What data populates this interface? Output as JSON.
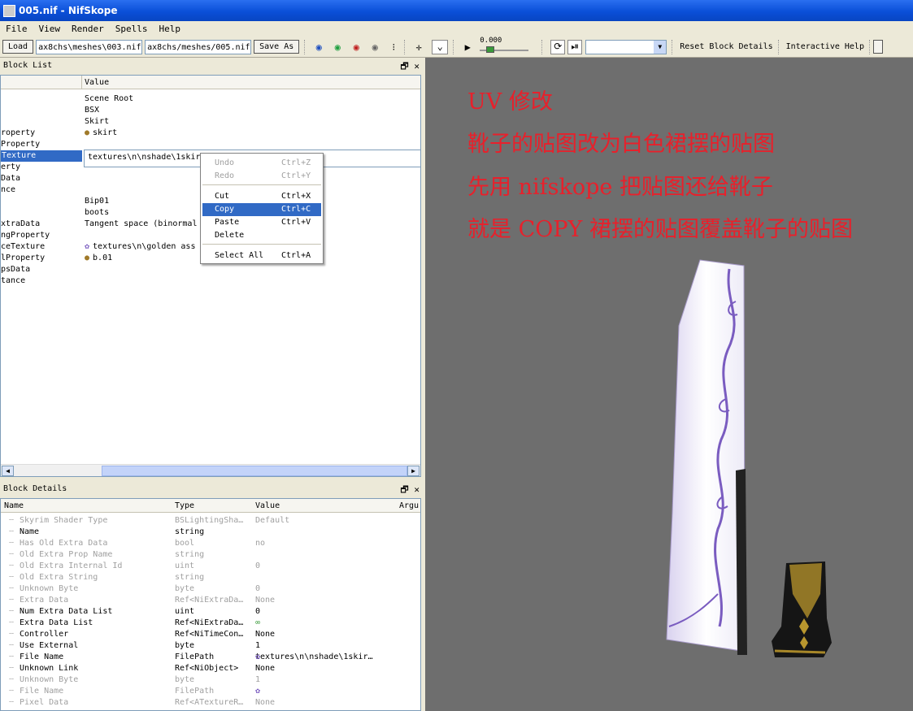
{
  "window": {
    "title": "005.nif - NifSkope"
  },
  "menu": [
    "File",
    "View",
    "Render",
    "Spells",
    "Help"
  ],
  "toolbar": {
    "load": "Load",
    "path_a": "ax8chs\\meshes\\003.nif",
    "path_b": "ax8chs/meshes/005.nif",
    "save_as": "Save As",
    "time": "0.000",
    "reset": "Reset Block Details",
    "help": "Interactive Help"
  },
  "block_list": {
    "title": "Block List",
    "col_value": "Value",
    "rows": [
      {
        "c1": "",
        "c2": "Scene Root"
      },
      {
        "c1": "",
        "c2": "BSX"
      },
      {
        "c1": "",
        "c2": "Skirt"
      },
      {
        "c1": "roperty",
        "c2": "skirt",
        "icon": "palette"
      },
      {
        "c1": "Property",
        "c2": ""
      },
      {
        "c1": "Texture",
        "c2": ""
      },
      {
        "c1": "erty",
        "c2": ""
      },
      {
        "c1": "Data",
        "c2": ""
      },
      {
        "c1": "nce",
        "c2": ""
      },
      {
        "c1": "",
        "c2": "Bip01"
      },
      {
        "c1": "",
        "c2": "boots"
      },
      {
        "c1": "xtraData",
        "c2": "Tangent space (binormal"
      },
      {
        "c1": "ngProperty",
        "c2": ""
      },
      {
        "c1": "ceTexture",
        "c2": "textures\\n\\golden ass",
        "icon": "flower"
      },
      {
        "c1": "lProperty",
        "c2": "b.01",
        "icon": "palette"
      },
      {
        "c1": "psData",
        "c2": ""
      },
      {
        "c1": "tance",
        "c2": ""
      }
    ],
    "edit_value": "textures\\n\\nshade\\1skirt"
  },
  "context_menu": {
    "items": [
      {
        "label": "Undo",
        "key": "Ctrl+Z",
        "disabled": true
      },
      {
        "label": "Redo",
        "key": "Ctrl+Y",
        "disabled": true
      },
      {
        "label": "Cut",
        "key": "Ctrl+X"
      },
      {
        "label": "Copy",
        "key": "Ctrl+C",
        "highlighted": true
      },
      {
        "label": "Paste",
        "key": "Ctrl+V"
      },
      {
        "label": "Delete",
        "key": ""
      },
      {
        "label": "Select All",
        "key": "Ctrl+A"
      }
    ]
  },
  "block_details": {
    "title": "Block Details",
    "cols": [
      "Name",
      "Type",
      "Value",
      "Argu"
    ],
    "rows": [
      {
        "name": "Skyrim Shader Type",
        "type": "BSLightingSha…",
        "value": "Default",
        "dim": true
      },
      {
        "name": "Name",
        "type": "string",
        "value": ""
      },
      {
        "name": "Has Old Extra Data",
        "type": "bool",
        "value": "no",
        "dim": true
      },
      {
        "name": "Old Extra Prop Name",
        "type": "string",
        "value": "",
        "dim": true
      },
      {
        "name": "Old Extra Internal Id",
        "type": "uint",
        "value": "0",
        "dim": true
      },
      {
        "name": "Old Extra String",
        "type": "string",
        "value": "",
        "dim": true
      },
      {
        "name": "Unknown Byte",
        "type": "byte",
        "value": "0",
        "dim": true
      },
      {
        "name": "Extra Data",
        "type": "Ref<NiExtraDa…",
        "value": "None",
        "dim": true
      },
      {
        "name": "Num Extra Data List",
        "type": "uint",
        "value": "0"
      },
      {
        "name": "Extra Data List",
        "type": "Ref<NiExtraDa…",
        "value": "",
        "icon": "link"
      },
      {
        "name": "Controller",
        "type": "Ref<NiTimeCon…",
        "value": "None"
      },
      {
        "name": "Use External",
        "type": "byte",
        "value": "1"
      },
      {
        "name": "File Name",
        "type": "FilePath",
        "value": "textures\\n\\nshade\\1skir…",
        "icon": "flower"
      },
      {
        "name": "Unknown Link",
        "type": "Ref<NiObject>",
        "value": "None"
      },
      {
        "name": "Unknown Byte",
        "type": "byte",
        "value": "1",
        "dim": true
      },
      {
        "name": "File Name",
        "type": "FilePath",
        "value": "",
        "icon": "flower",
        "dim": true
      },
      {
        "name": "Pixel Data",
        "type": "Ref<ATextureR…",
        "value": "None",
        "dim": true
      }
    ]
  },
  "notes": [
    "UV 修改",
    "靴子的贴图改为白色裙摆的贴图",
    "先用 nifskope 把贴图还给靴子",
    "就是 COPY 裙摆的贴图覆盖靴子的贴图"
  ],
  "colors": {
    "note": "#e8202b",
    "selection": "#316ac5",
    "render_bg": "#6e6e6e"
  }
}
